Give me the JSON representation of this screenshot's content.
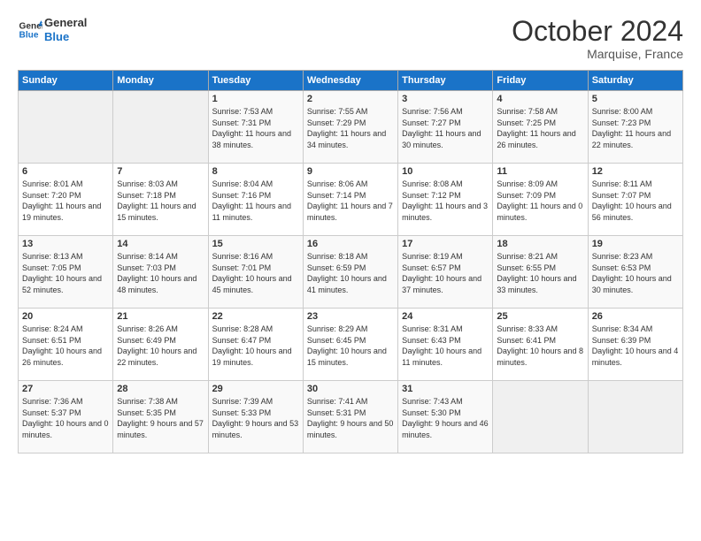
{
  "logo": {
    "line1": "General",
    "line2": "Blue"
  },
  "title": "October 2024",
  "location": "Marquise, France",
  "days_of_week": [
    "Sunday",
    "Monday",
    "Tuesday",
    "Wednesday",
    "Thursday",
    "Friday",
    "Saturday"
  ],
  "weeks": [
    [
      {
        "day": "",
        "content": ""
      },
      {
        "day": "",
        "content": ""
      },
      {
        "day": "1",
        "content": "Sunrise: 7:53 AM\nSunset: 7:31 PM\nDaylight: 11 hours and 38 minutes."
      },
      {
        "day": "2",
        "content": "Sunrise: 7:55 AM\nSunset: 7:29 PM\nDaylight: 11 hours and 34 minutes."
      },
      {
        "day": "3",
        "content": "Sunrise: 7:56 AM\nSunset: 7:27 PM\nDaylight: 11 hours and 30 minutes."
      },
      {
        "day": "4",
        "content": "Sunrise: 7:58 AM\nSunset: 7:25 PM\nDaylight: 11 hours and 26 minutes."
      },
      {
        "day": "5",
        "content": "Sunrise: 8:00 AM\nSunset: 7:23 PM\nDaylight: 11 hours and 22 minutes."
      }
    ],
    [
      {
        "day": "6",
        "content": "Sunrise: 8:01 AM\nSunset: 7:20 PM\nDaylight: 11 hours and 19 minutes."
      },
      {
        "day": "7",
        "content": "Sunrise: 8:03 AM\nSunset: 7:18 PM\nDaylight: 11 hours and 15 minutes."
      },
      {
        "day": "8",
        "content": "Sunrise: 8:04 AM\nSunset: 7:16 PM\nDaylight: 11 hours and 11 minutes."
      },
      {
        "day": "9",
        "content": "Sunrise: 8:06 AM\nSunset: 7:14 PM\nDaylight: 11 hours and 7 minutes."
      },
      {
        "day": "10",
        "content": "Sunrise: 8:08 AM\nSunset: 7:12 PM\nDaylight: 11 hours and 3 minutes."
      },
      {
        "day": "11",
        "content": "Sunrise: 8:09 AM\nSunset: 7:09 PM\nDaylight: 11 hours and 0 minutes."
      },
      {
        "day": "12",
        "content": "Sunrise: 8:11 AM\nSunset: 7:07 PM\nDaylight: 10 hours and 56 minutes."
      }
    ],
    [
      {
        "day": "13",
        "content": "Sunrise: 8:13 AM\nSunset: 7:05 PM\nDaylight: 10 hours and 52 minutes."
      },
      {
        "day": "14",
        "content": "Sunrise: 8:14 AM\nSunset: 7:03 PM\nDaylight: 10 hours and 48 minutes."
      },
      {
        "day": "15",
        "content": "Sunrise: 8:16 AM\nSunset: 7:01 PM\nDaylight: 10 hours and 45 minutes."
      },
      {
        "day": "16",
        "content": "Sunrise: 8:18 AM\nSunset: 6:59 PM\nDaylight: 10 hours and 41 minutes."
      },
      {
        "day": "17",
        "content": "Sunrise: 8:19 AM\nSunset: 6:57 PM\nDaylight: 10 hours and 37 minutes."
      },
      {
        "day": "18",
        "content": "Sunrise: 8:21 AM\nSunset: 6:55 PM\nDaylight: 10 hours and 33 minutes."
      },
      {
        "day": "19",
        "content": "Sunrise: 8:23 AM\nSunset: 6:53 PM\nDaylight: 10 hours and 30 minutes."
      }
    ],
    [
      {
        "day": "20",
        "content": "Sunrise: 8:24 AM\nSunset: 6:51 PM\nDaylight: 10 hours and 26 minutes."
      },
      {
        "day": "21",
        "content": "Sunrise: 8:26 AM\nSunset: 6:49 PM\nDaylight: 10 hours and 22 minutes."
      },
      {
        "day": "22",
        "content": "Sunrise: 8:28 AM\nSunset: 6:47 PM\nDaylight: 10 hours and 19 minutes."
      },
      {
        "day": "23",
        "content": "Sunrise: 8:29 AM\nSunset: 6:45 PM\nDaylight: 10 hours and 15 minutes."
      },
      {
        "day": "24",
        "content": "Sunrise: 8:31 AM\nSunset: 6:43 PM\nDaylight: 10 hours and 11 minutes."
      },
      {
        "day": "25",
        "content": "Sunrise: 8:33 AM\nSunset: 6:41 PM\nDaylight: 10 hours and 8 minutes."
      },
      {
        "day": "26",
        "content": "Sunrise: 8:34 AM\nSunset: 6:39 PM\nDaylight: 10 hours and 4 minutes."
      }
    ],
    [
      {
        "day": "27",
        "content": "Sunrise: 7:36 AM\nSunset: 5:37 PM\nDaylight: 10 hours and 0 minutes."
      },
      {
        "day": "28",
        "content": "Sunrise: 7:38 AM\nSunset: 5:35 PM\nDaylight: 9 hours and 57 minutes."
      },
      {
        "day": "29",
        "content": "Sunrise: 7:39 AM\nSunset: 5:33 PM\nDaylight: 9 hours and 53 minutes."
      },
      {
        "day": "30",
        "content": "Sunrise: 7:41 AM\nSunset: 5:31 PM\nDaylight: 9 hours and 50 minutes."
      },
      {
        "day": "31",
        "content": "Sunrise: 7:43 AM\nSunset: 5:30 PM\nDaylight: 9 hours and 46 minutes."
      },
      {
        "day": "",
        "content": ""
      },
      {
        "day": "",
        "content": ""
      }
    ]
  ]
}
